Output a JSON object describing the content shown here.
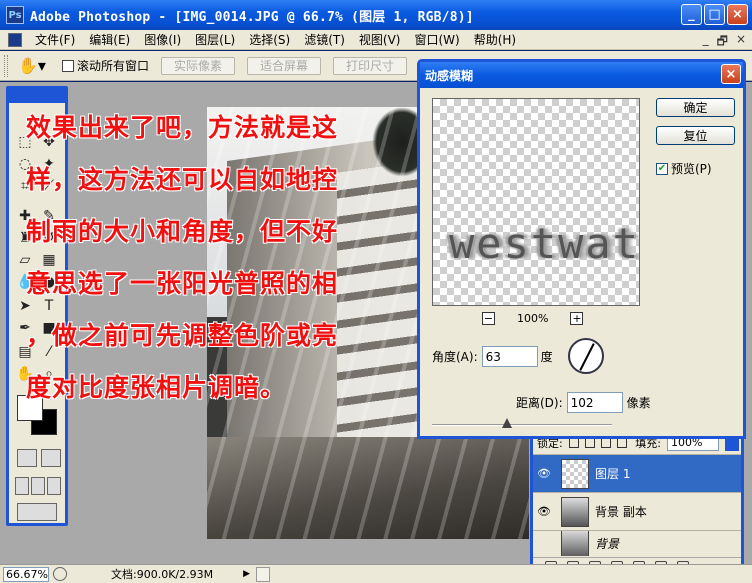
{
  "window": {
    "title": "Adobe Photoshop - [IMG_0014.JPG @ 66.7% (图层 1, RGB/8)]",
    "logo": "Ps",
    "controls": [
      "_",
      "□",
      "×"
    ]
  },
  "menubar": {
    "items": [
      "文件(F)",
      "编辑(E)",
      "图像(I)",
      "图层(L)",
      "选择(S)",
      "滤镜(T)",
      "视图(V)",
      "窗口(W)",
      "帮助(H)"
    ],
    "doc_controls": [
      "_",
      "🗗",
      "×"
    ]
  },
  "options": {
    "scroll_all_label": "滚动所有窗口",
    "buttons": [
      "实际像素",
      "适合屏幕",
      "打印尺寸"
    ]
  },
  "overlay_text": {
    "lines": [
      "效果出来了吧，方法就是这",
      "样，这方法还可以自如地控",
      "制雨的大小和角度，但不好",
      "意思选了一张阳光普照的相",
      "，做之前可先调整色阶或亮",
      "度对比度张相片调暗。"
    ]
  },
  "dialog": {
    "title": "动感模糊",
    "close": "×",
    "preview_text": "westwater",
    "ok_label": "确定",
    "reset_label": "复位",
    "preview_label": "预览(P)",
    "zoom_minus": "−",
    "zoom_plus": "+",
    "zoom_value": "100%",
    "angle_label": "角度(A):",
    "angle_value": "63",
    "angle_unit": "度",
    "distance_label": "距离(D):",
    "distance_value": "102",
    "distance_unit": "像素"
  },
  "layers": {
    "lock_label": "锁定:",
    "fill_label": "填充:",
    "fill_value": "100%",
    "items": [
      {
        "name": "图层 1"
      },
      {
        "name": "背景 副本"
      },
      {
        "name": "背景"
      }
    ]
  },
  "status": {
    "zoom": "66.67%",
    "doc_info": "文档:900.0K/2.93M",
    "arrow": "▶"
  }
}
